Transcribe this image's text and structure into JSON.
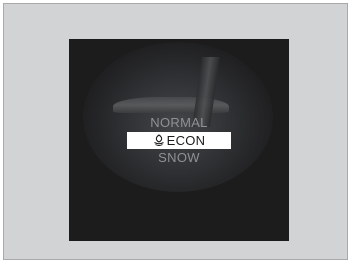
{
  "drive_mode_menu": {
    "items": [
      {
        "label": "NORMAL",
        "selected": false
      },
      {
        "label": "ECON",
        "selected": true,
        "icon": "econ-leaf-icon"
      },
      {
        "label": "SNOW",
        "selected": false
      }
    ]
  },
  "colors": {
    "outer_panel": "#d2d3d4",
    "screen_background": "#1c1c1d",
    "selected_highlight": "#ffffff",
    "unselected_text": "#8f9194"
  }
}
